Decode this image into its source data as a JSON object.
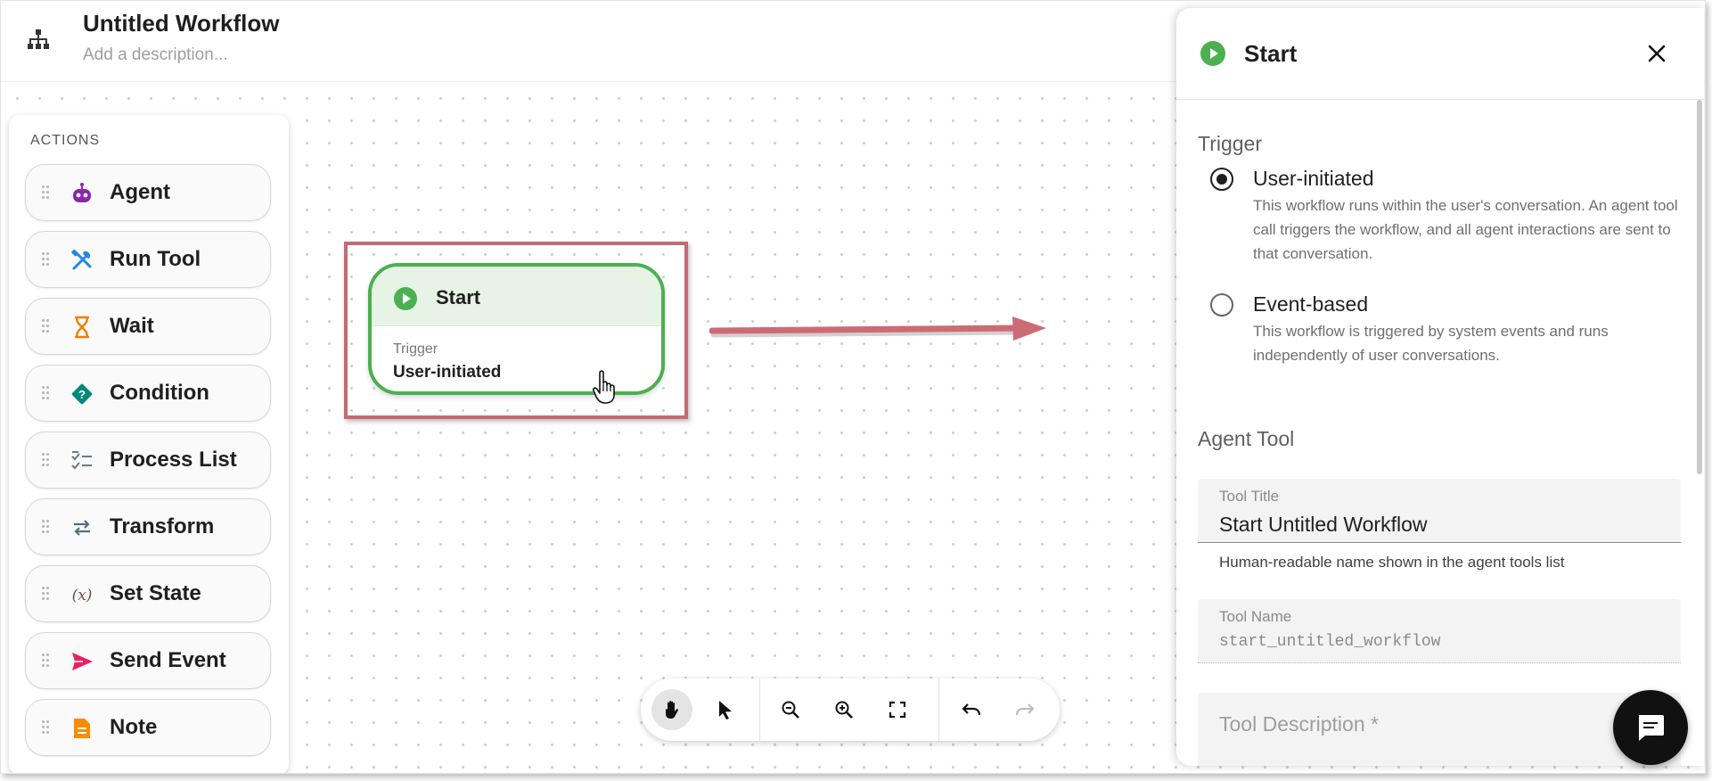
{
  "header": {
    "title": "Untitled Workflow",
    "description_placeholder": "Add a description..."
  },
  "actions": {
    "title": "ACTIONS",
    "items": [
      {
        "label": "Agent",
        "icon": "robot-icon",
        "color": "#8e24aa"
      },
      {
        "label": "Run Tool",
        "icon": "tools-icon",
        "color": "#1e88e5"
      },
      {
        "label": "Wait",
        "icon": "hourglass-icon",
        "color": "#f57c00"
      },
      {
        "label": "Condition",
        "icon": "question-diamond-icon",
        "color": "#00897b"
      },
      {
        "label": "Process List",
        "icon": "checklist-icon",
        "color": "#607d8b"
      },
      {
        "label": "Transform",
        "icon": "swap-arrows-icon",
        "color": "#546e7a"
      },
      {
        "label": "Set State",
        "icon": "variable-icon",
        "color": "#6d4c41"
      },
      {
        "label": "Send Event",
        "icon": "send-icon",
        "color": "#e91e63"
      },
      {
        "label": "Note",
        "icon": "note-icon",
        "color": "#fb8c00"
      }
    ]
  },
  "node": {
    "title": "Start",
    "subtitle": "Trigger",
    "value": "User-initiated",
    "accent": "#4caf50"
  },
  "toolbar": {
    "buttons": [
      "pan-hand-icon",
      "select-pointer-icon",
      "zoom-out-icon",
      "zoom-in-icon",
      "fit-view-icon",
      "undo-icon",
      "redo-icon"
    ],
    "active": "pan-hand-icon"
  },
  "panel": {
    "title": "Start",
    "trigger_label": "Trigger",
    "options": [
      {
        "title": "User-initiated",
        "description": "This workflow runs within the user's conversation. An agent tool call triggers the workflow, and all agent interactions are sent to that conversation.",
        "selected": true
      },
      {
        "title": "Event-based",
        "description": "This workflow is triggered by system events and runs independently of user conversations.",
        "selected": false
      }
    ],
    "agent_tool_label": "Agent Tool",
    "tool_title": {
      "label": "Tool Title",
      "value": "Start Untitled Workflow",
      "help": "Human-readable name shown in the agent tools list"
    },
    "tool_name": {
      "label": "Tool Name",
      "value": "start_untitled_workflow"
    },
    "tool_description": {
      "placeholder": "Tool Description *"
    }
  },
  "colors": {
    "start_green": "#4caf50",
    "highlight_red": "#c46a72",
    "fab_bg": "#111111"
  }
}
